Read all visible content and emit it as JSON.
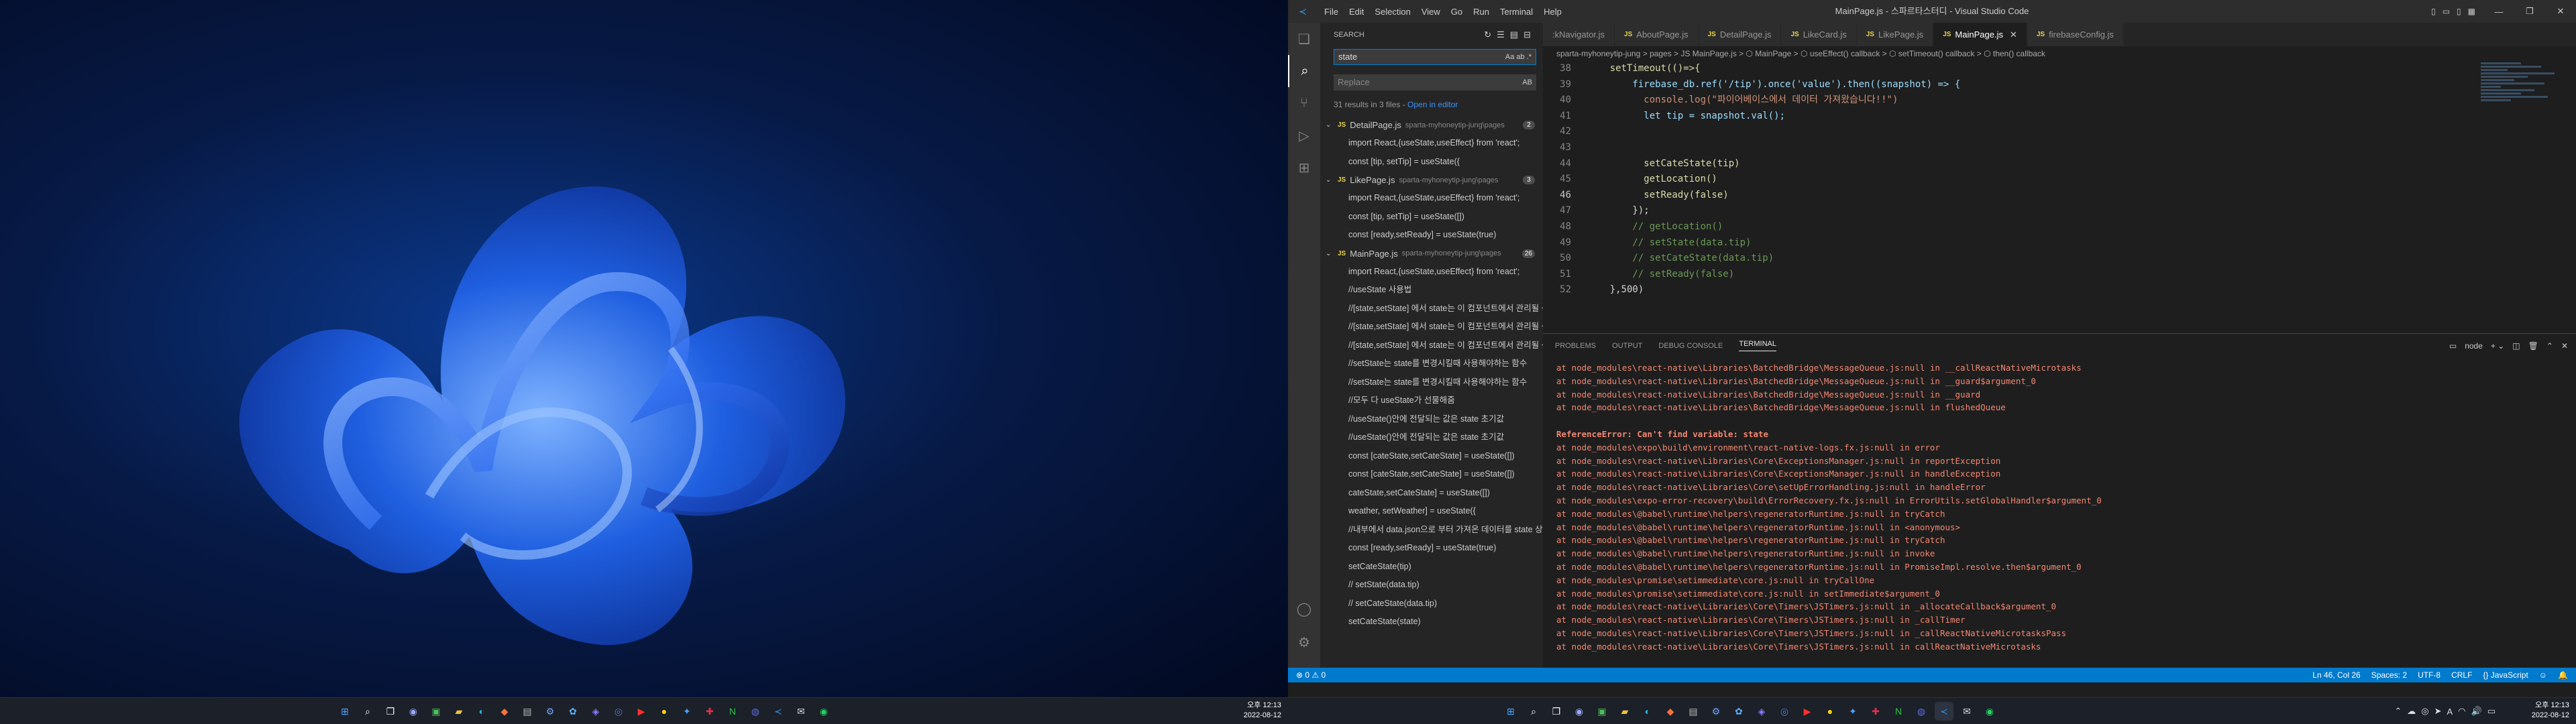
{
  "left_taskbar": {
    "clock_time": "오후 12:13",
    "clock_date": "2022-08-12"
  },
  "vscode": {
    "menu": [
      "File",
      "Edit",
      "Selection",
      "View",
      "Go",
      "Run",
      "Terminal",
      "Help"
    ],
    "window_title": "MainPage.js - 스파르타스터디 - Visual Studio Code",
    "sidebar": {
      "header": "SEARCH",
      "search_value": "state",
      "search_opts": "Aa  ab  .*",
      "replace_placeholder": "Replace",
      "replace_opts": "AB",
      "results_summary": "31 results in 3 files - ",
      "open_in_editor": "Open in editor",
      "results": [
        {
          "file": "DetailPage.js",
          "path": "sparta-myhoneytip-jung\\pages",
          "count": "2",
          "matches": [
            "import React,{useState,useEffect} from 'react';",
            "const [tip, setTip] = useState({"
          ]
        },
        {
          "file": "LikePage.js",
          "path": "sparta-myhoneytip-jung\\pages",
          "count": "3",
          "matches": [
            "import React,{useState,useEffect} from 'react';",
            "const [tip, setTip] = useState([])",
            "const [ready,setReady] = useState(true)"
          ]
        },
        {
          "file": "MainPage.js",
          "path": "sparta-myhoneytip-jung\\pages",
          "count": "26",
          "matches": [
            "import React,{useState,useEffect} from 'react';",
            "//useState 사용법",
            "//[state,setState] 에서 state는 이 컴포넌트에서 관리될 상태 데이터를 담고 있는 변수",
            "//[state,setState] 에서 state는 이 컴포넌트에서 관리될 상태 데이터를 담고 있는 변수",
            "//[state,setState] 에서 state는 이 컴포넌트에서 관리될 상태 데이터를 담고 있는 변수",
            "//setState는 state를 변경시킬때 사용해야하는 함수",
            "//setState는 state를 변경시킬때 사용해야하는 함수",
            "//모두 다 useState가 선물해줌",
            "//useState()안에 전달되는 값은 state 초기값",
            "//useState()안에 전달되는 값은 state 초기값",
            "const [cateState,setCateState] = useState([])",
            "const [cateState,setCateState] = useState([])",
            "cateState,setCateState] = useState([])",
            "weather, setWeather] = useState({",
            "//내부에서 data.json으로 부터 가져온 데이터를 state 상태에 담고 있음",
            "const [ready,setReady] = useState(true)",
            "setCateState(tip)",
            "// setState(data.tip)",
            "// setCateState(data.tip)",
            "setCateState(state)"
          ]
        }
      ]
    },
    "tabs": [
      {
        "label": ":kNavigator.js",
        "active": false
      },
      {
        "label": "AboutPage.js",
        "active": false
      },
      {
        "label": "DetailPage.js",
        "active": false
      },
      {
        "label": "LikeCard.js",
        "active": false
      },
      {
        "label": "LikePage.js",
        "active": false
      },
      {
        "label": "MainPage.js",
        "active": true
      },
      {
        "label": "firebaseConfig.js",
        "active": false
      }
    ],
    "breadcrumb": "sparta-myhoneytip-jung  >  pages  >  JS MainPage.js  >  ⬡ MainPage  >  ⬡ useEffect() callback  >  ⬡ setTimeout() callback  >  ⬡ then() callback",
    "code_lines": [
      {
        "num": "38",
        "text": "    setTimeout(()=>{"
      },
      {
        "num": "39",
        "text": "        firebase_db.ref('/tip').once('value').then((snapshot) => {"
      },
      {
        "num": "40",
        "text": "          console.log(\"파이어베이스에서 데이터 가져왔습니다!!\")"
      },
      {
        "num": "41",
        "text": "          let tip = snapshot.val();"
      },
      {
        "num": "42",
        "text": ""
      },
      {
        "num": "43",
        "text": ""
      },
      {
        "num": "44",
        "text": "          setCateState(tip)"
      },
      {
        "num": "45",
        "text": "          getLocation()"
      },
      {
        "num": "46",
        "text": "          setReady(false)"
      },
      {
        "num": "47",
        "text": "        });"
      },
      {
        "num": "48",
        "text": "        // getLocation()"
      },
      {
        "num": "49",
        "text": "        // setState(data.tip)"
      },
      {
        "num": "50",
        "text": "        // setCateState(data.tip)"
      },
      {
        "num": "51",
        "text": "        // setReady(false)"
      },
      {
        "num": "52",
        "text": "    },500)"
      }
    ],
    "panel_tabs": [
      "PROBLEMS",
      "OUTPUT",
      "DEBUG CONSOLE",
      "TERMINAL"
    ],
    "panel_active": "TERMINAL",
    "terminal_shell": "node",
    "terminal_lines": [
      "at node_modules\\react-native\\Libraries\\BatchedBridge\\MessageQueue.js:null in __callReactNativeMicrotasks",
      "at node_modules\\react-native\\Libraries\\BatchedBridge\\MessageQueue.js:null in __guard$argument_0",
      "at node_modules\\react-native\\Libraries\\BatchedBridge\\MessageQueue.js:null in __guard",
      "at node_modules\\react-native\\Libraries\\BatchedBridge\\MessageQueue.js:null in flushedQueue",
      "",
      "ReferenceError: Can't find variable: state",
      "at node_modules\\expo\\build\\environment\\react-native-logs.fx.js:null in error",
      "at node_modules\\react-native\\Libraries\\Core\\ExceptionsManager.js:null in reportException",
      "at node_modules\\react-native\\Libraries\\Core\\ExceptionsManager.js:null in handleException",
      "at node_modules\\react-native\\Libraries\\Core\\setUpErrorHandling.js:null in handleError",
      "at node_modules\\expo-error-recovery\\build\\ErrorRecovery.fx.js:null in ErrorUtils.setGlobalHandler$argument_0",
      "at node_modules\\@babel\\runtime\\helpers\\regeneratorRuntime.js:null in tryCatch",
      "at node_modules\\@babel\\runtime\\helpers\\regeneratorRuntime.js:null in <anonymous>",
      "at node_modules\\@babel\\runtime\\helpers\\regeneratorRuntime.js:null in tryCatch",
      "at node_modules\\@babel\\runtime\\helpers\\regeneratorRuntime.js:null in invoke",
      "at node_modules\\@babel\\runtime\\helpers\\regeneratorRuntime.js:null in PromiseImpl.resolve.then$argument_0",
      "at node_modules\\promise\\setimmediate\\core.js:null in tryCallOne",
      "at node_modules\\promise\\setimmediate\\core.js:null in setImmediate$argument_0",
      "at node_modules\\react-native\\Libraries\\Core\\Timers\\JSTimers.js:null in _allocateCallback$argument_0",
      "at node_modules\\react-native\\Libraries\\Core\\Timers\\JSTimers.js:null in _callTimer",
      "at node_modules\\react-native\\Libraries\\Core\\Timers\\JSTimers.js:null in _callReactNativeMicrotasksPass",
      "at node_modules\\react-native\\Libraries\\Core\\Timers\\JSTimers.js:null in callReactNativeMicrotasks"
    ],
    "status": {
      "left": "⊗ 0  ⚠ 0",
      "ln_col": "Ln 46, Col 26",
      "spaces": "Spaces: 2",
      "encoding": "UTF-8",
      "eol": "CRLF",
      "language": "{} JavaScript"
    }
  },
  "right_taskbar": {
    "clock_time": "오후 12:13",
    "clock_date": "2022-08-12"
  },
  "colors": {
    "accent": "#007acc",
    "highlight": "#613214",
    "keyword": "#569cd6",
    "string": "#ce9178",
    "comment": "#6a9955",
    "function": "#dcdcaa"
  }
}
